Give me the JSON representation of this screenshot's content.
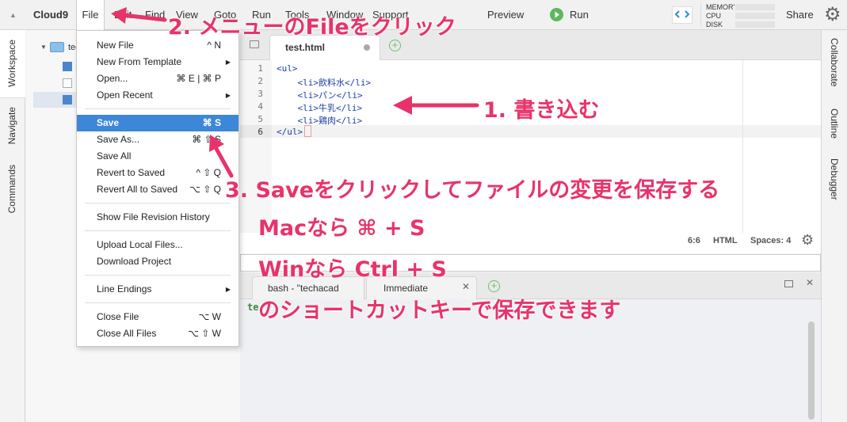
{
  "app": {
    "brand": "Cloud9"
  },
  "menubar": {
    "file": "File",
    "edit": "Edit",
    "find": "Find",
    "view": "View",
    "goto": "Goto",
    "run": "Run",
    "tools": "Tools",
    "window": "Window",
    "support": "Support",
    "preview": "Preview",
    "run_button": "Run",
    "share": "Share"
  },
  "stats": {
    "memory": "MEMORY",
    "cpu": "CPU",
    "disk": "DISK"
  },
  "left_tabs": {
    "workspace": "Workspace",
    "navigate": "Navigate",
    "commands": "Commands"
  },
  "right_tabs": {
    "collaborate": "Collaborate",
    "outline": "Outline",
    "debugger": "Debugger"
  },
  "tree": {
    "root_label": "techacad"
  },
  "file_menu": {
    "items": [
      {
        "label": "New File",
        "shortcut": "^ N"
      },
      {
        "label": "New From Template",
        "submenu": true
      },
      {
        "label": "Open...",
        "shortcut": "⌘ E | ⌘ P"
      },
      {
        "label": "Open Recent",
        "submenu": true
      },
      {
        "label": "Save",
        "shortcut": "⌘ S",
        "active": true
      },
      {
        "label": "Save As...",
        "shortcut": "⌘ ⇧ S"
      },
      {
        "label": "Save All"
      },
      {
        "label": "Revert to Saved",
        "shortcut": "^ ⇧ Q"
      },
      {
        "label": "Revert All to Saved",
        "shortcut": "⌥ ⇧ Q"
      },
      {
        "label": "Show File Revision History"
      },
      {
        "label": "Upload Local Files..."
      },
      {
        "label": "Download Project"
      },
      {
        "label": "Line Endings",
        "submenu": true
      },
      {
        "label": "Close File",
        "shortcut": "⌥ W"
      },
      {
        "label": "Close All Files",
        "shortcut": "⌥ ⇧ W"
      }
    ]
  },
  "editor": {
    "tab_label": "test.html",
    "line_numbers": [
      "1",
      "2",
      "3",
      "4",
      "5",
      "6"
    ],
    "lines": [
      "<ul>",
      "    <li>飲料水</li>",
      "    <li>パン</li>",
      "    <li>牛乳</li>",
      "    <li>鶏肉</li>",
      "</ul>"
    ],
    "status": {
      "cursor": "6:6",
      "mode": "HTML",
      "spaces": "Spaces: 4"
    }
  },
  "terminal": {
    "tab1": "bash - \"techacad",
    "tab2": "Immediate",
    "prompt_fragment": "te"
  },
  "annotations": {
    "step1": "1. 書き込む",
    "step2": "2. メニューのFileをクリック",
    "step3": "3. Saveをクリックしてファイルの変更を保存する",
    "mac": "Macなら ⌘ + S",
    "win": "Winなら Ctrl + S",
    "shortcut_note": "のショートカットキーで保存できます"
  },
  "colors": {
    "accent": "#3d87d8",
    "annotation": "#e8336a",
    "code_tag": "#1d3fa8",
    "run_green": "#5cb85c"
  }
}
